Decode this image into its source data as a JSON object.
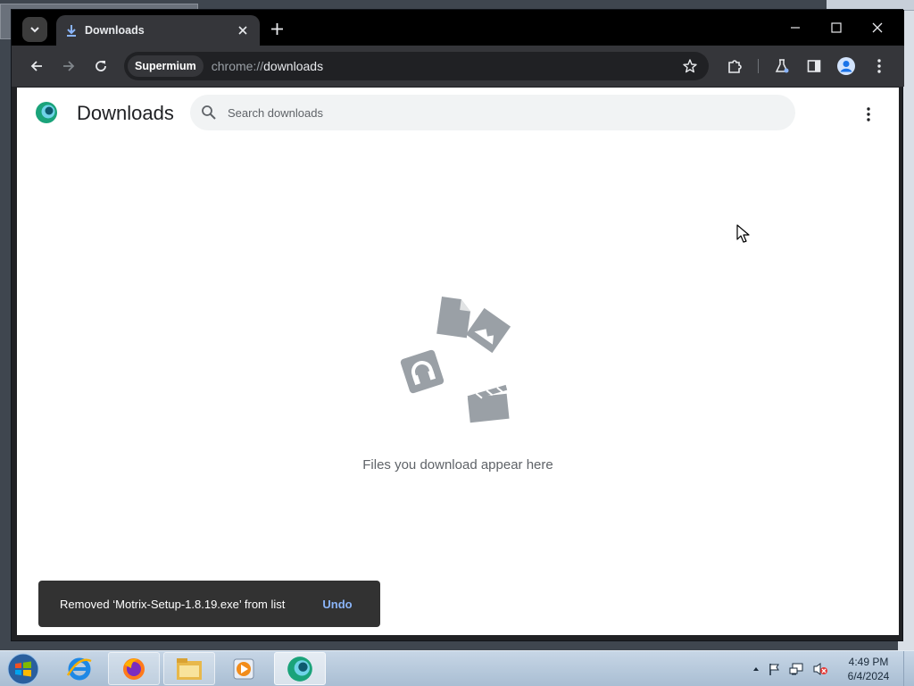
{
  "browser": {
    "tab_title": "Downloads",
    "omnibox_chip": "Supermium",
    "url_scheme": "chrome://",
    "url_path": "downloads"
  },
  "page": {
    "title": "Downloads",
    "search_placeholder": "Search downloads",
    "empty_message": "Files you download appear here"
  },
  "toast": {
    "message": "Removed ‘Motrix-Setup-1.8.19.exe’ from list",
    "action": "Undo"
  },
  "taskbar": {
    "apps": [
      "Internet Explorer",
      "Firefox",
      "File Explorer",
      "Media Player",
      "Supermium"
    ],
    "time": "4:49 PM",
    "date": "6/4/2024"
  },
  "colors": {
    "accent": "#8ab4f8",
    "toolbar": "#35363a",
    "toast": "#323232"
  }
}
